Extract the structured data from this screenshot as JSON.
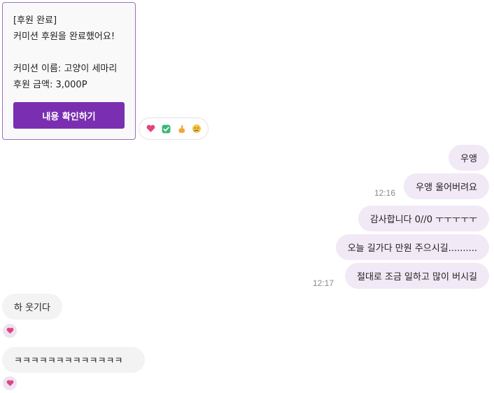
{
  "card": {
    "header": "[후원 완료]",
    "message": "커미션 후원을 완료했어요!",
    "name_line": "커미션 이름: 고양이 세마리",
    "amount_line": "후원 금액: 3,000P",
    "button_label": "내용 확인하기"
  },
  "reactions": [
    "heart-icon",
    "check-icon",
    "pointing-hand-icon",
    "crying-face-icon"
  ],
  "colors": {
    "accent": "#7a2fb0",
    "outgoing_bubble": "#f1e9f6",
    "incoming_bubble": "#f3f3f3",
    "heart": "#e0457b"
  },
  "messages": {
    "m1": "우앵",
    "m2": "우앵 울어버려요",
    "t1": "12:16",
    "m3": "감사합니다 0//0 ㅜㅜㅜㅜㅜ",
    "m4": "오늘 길가다 만원 주으시길..........",
    "m5": "절대로 조금 일하고 많이 버시길",
    "t2": "12:17",
    "m6": "하 웃기다",
    "m7": "ㅋㅋㅋㅋㅋㅋㅋㅋㅋㅋㅋㅋㅋ"
  }
}
